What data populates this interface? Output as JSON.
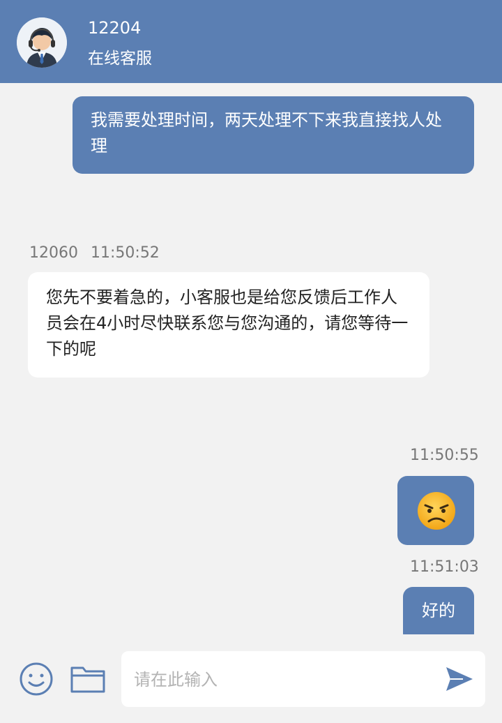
{
  "header": {
    "agent_id": "12204",
    "agent_title": "在线客服"
  },
  "messages": [
    {
      "side": "out",
      "text": "我需要处理时间，两天处理不下来我直接找人处理"
    },
    {
      "side": "in",
      "sender": "12060",
      "time": "11:50:52",
      "text": "您先不要着急的，小客服也是给您反馈后工作人员会在4小时尽快联系您与您沟通的，请您等待一下的呢"
    },
    {
      "side": "out",
      "time": "11:50:55",
      "emoji": "😠"
    },
    {
      "side": "out",
      "time": "11:51:03",
      "text": "好的"
    }
  ],
  "composer": {
    "placeholder": "请在此输入"
  },
  "icons": {
    "emoji_button": "smiley-icon",
    "file_button": "folder-icon",
    "send_button": "send-icon"
  },
  "colors": {
    "accent": "#5b7fb3",
    "background": "#f2f2f2"
  }
}
